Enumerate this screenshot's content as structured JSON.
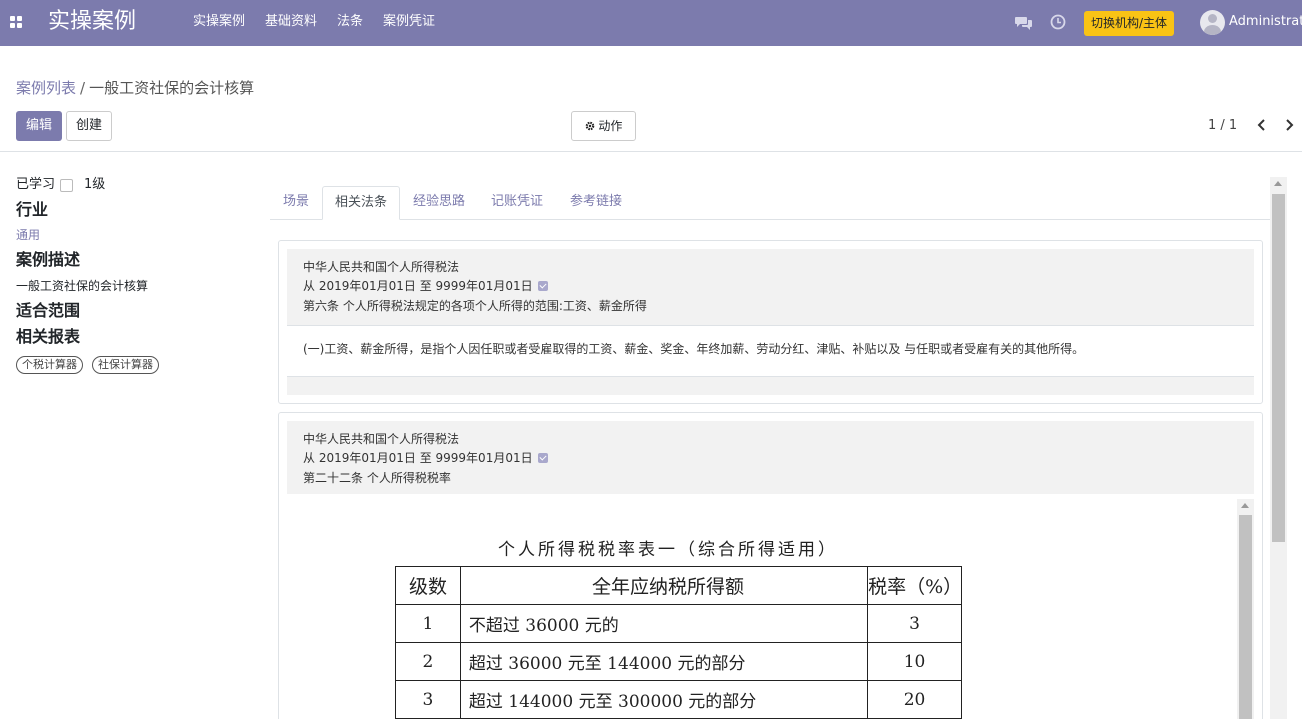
{
  "navbar": {
    "brand": "实操案例",
    "menu": [
      "实操案例",
      "基础资料",
      "法条",
      "案例凭证"
    ],
    "switch_button": "切换机构/主体",
    "user": "Administrator",
    "bg_color": "#7c7bad",
    "accent_color": "#f9c315"
  },
  "breadcrumb": {
    "parent": "案例列表",
    "separator": "/",
    "current": "一般工资社保的会计核算"
  },
  "toolbar": {
    "edit": "编辑",
    "create": "创建",
    "action": "动作",
    "action_icon": "gear-icon"
  },
  "pager": {
    "value": "1 / 1",
    "prev_icon": "chevron-left-icon",
    "next_icon": "chevron-right-icon"
  },
  "sidebar": {
    "learned_label": "已学习",
    "learned_checked": false,
    "level": "1级",
    "industry_label": "行业",
    "industry_value": "通用",
    "desc_label": "案例描述",
    "desc_value": "一般工资社保的会计核算",
    "scope_label": "适合范围",
    "reports_label": "相关报表",
    "reports": [
      "个税计算器",
      "社保计算器"
    ]
  },
  "tabs": [
    "场景",
    "相关法条",
    "经验思路",
    "记账凭证",
    "参考链接"
  ],
  "active_tab": 1,
  "laws": [
    {
      "name": "中华人民共和国个人所得税法",
      "period": "从 2019年01月01日 至 9999年01月01日",
      "period_checked": true,
      "article": "第六条 个人所得税法规定的各项个人所得的范围:工资、薪金所得",
      "content": "(一)工资、薪金所得，是指个人因任职或者受雇取得的工资、薪金、奖金、年终加薪、劳动分红、津贴、补贴以及 与任职或者受雇有关的其他所得。"
    },
    {
      "name": "中华人民共和国个人所得税法",
      "period": "从 2019年01月01日 至 9999年01月01日",
      "period_checked": true,
      "article": "第二十二条 个人所得税税率"
    }
  ],
  "tax_table": {
    "title": "个人所得税税率表一（综合所得适用）",
    "headers": [
      "级数",
      "全年应纳税所得额",
      "税率（%）"
    ],
    "rows": [
      [
        "1",
        "不超过 36000 元的",
        "3"
      ],
      [
        "2",
        "超过 36000 元至 144000 元的部分",
        "10"
      ],
      [
        "3",
        "超过 144000 元至 300000 元的部分",
        "20"
      ]
    ]
  }
}
